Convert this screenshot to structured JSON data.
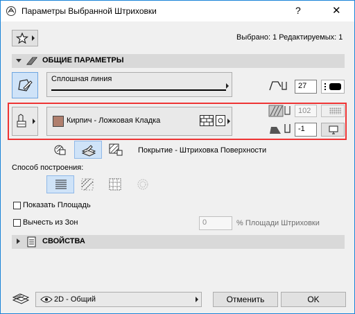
{
  "window": {
    "title": "Параметры Выбранной Штриховки",
    "help_label": "?",
    "close_label": "✕"
  },
  "header": {
    "selection_text": "Выбрано: 1 Редактируемых: 1"
  },
  "sections": {
    "general": "ОБЩИЕ ПАРАМЕТРЫ",
    "properties": "СВОЙСТВА"
  },
  "contour": {
    "line_type": "Сплошная линия",
    "pen_number": "27"
  },
  "fill": {
    "pattern_name": "Кирпич - Ложковая Кладка",
    "swatch_color": "#b07f6e",
    "bg_pen": "102",
    "fg_pen": "-1"
  },
  "fill_category": {
    "label": "Покрытие - Штриховка Поверхности"
  },
  "construction": {
    "label": "Способ построения:"
  },
  "options": {
    "show_area": "Показать Площадь",
    "subtract_zones": "Вычесть из Зон",
    "percent_value": "0",
    "percent_label": "% Площади Штриховки"
  },
  "footer": {
    "layer": "2D - Общий",
    "cancel": "Отменить",
    "ok": "OK"
  },
  "colors": {
    "accent": "#1883d7",
    "highlight": "#e33333"
  }
}
